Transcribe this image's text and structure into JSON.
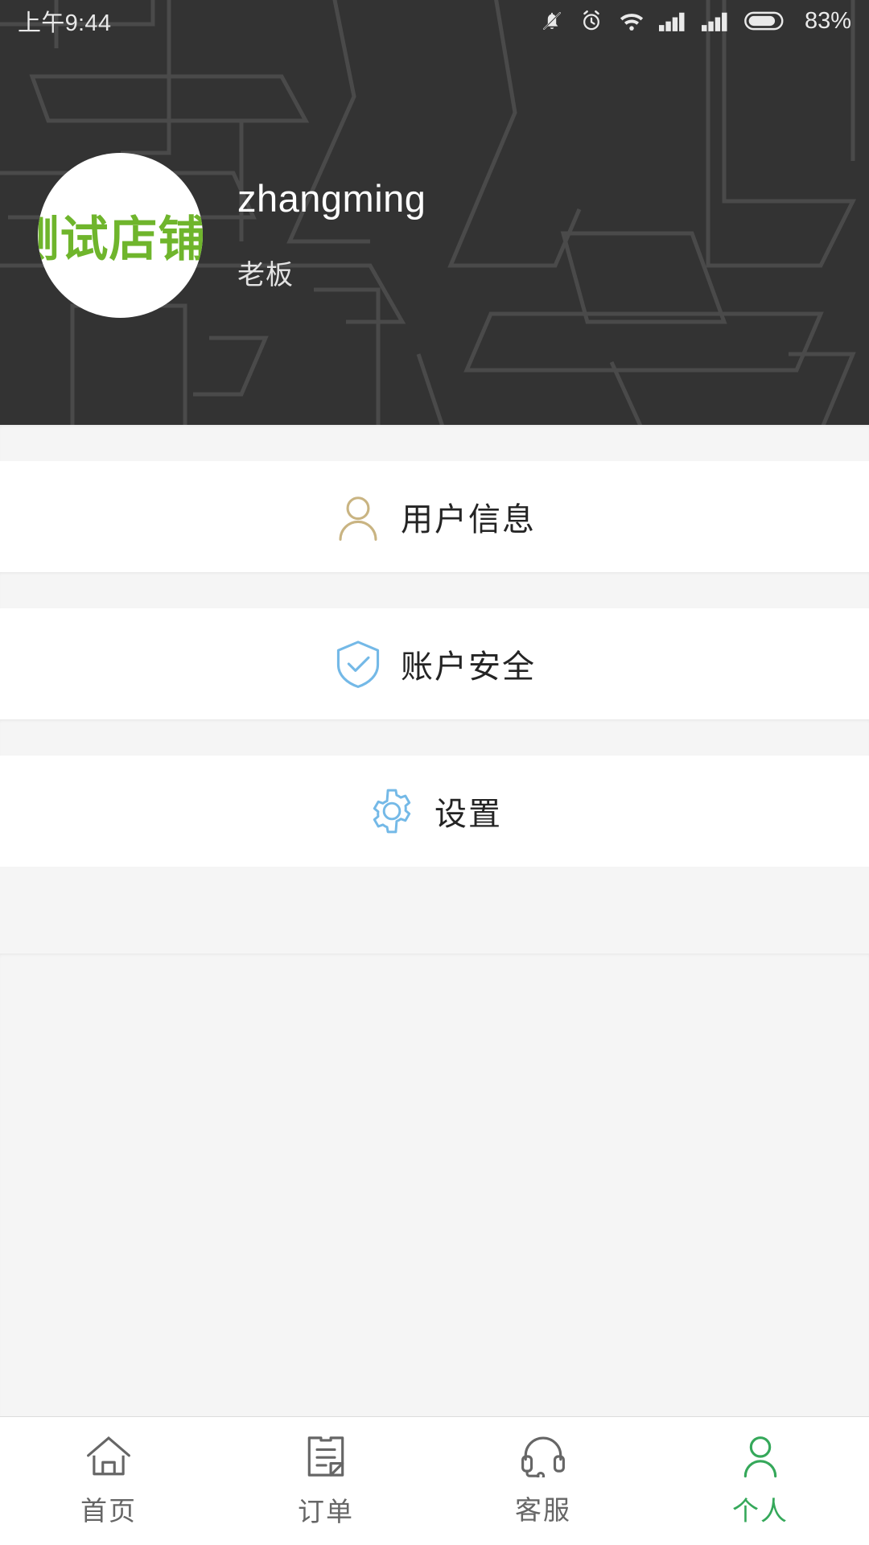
{
  "statusbar": {
    "time": "上午9:44",
    "battery_percent": "83%",
    "icons": [
      "bell-muted-icon",
      "alarm-clock-icon",
      "wifi-icon",
      "signal-bars-icon",
      "signal-bars-icon",
      "battery-icon"
    ]
  },
  "header": {
    "avatar_text": "测试店铺",
    "avatar_color": "#6fb52c",
    "name": "zhangming",
    "role": "老板",
    "background_color": "#333333"
  },
  "menu": {
    "items": [
      {
        "label": "用户信息",
        "icon": "user-icon",
        "color": "#c9b482"
      },
      {
        "label": "账户安全",
        "icon": "shield-check-icon",
        "color": "#74b9e7"
      },
      {
        "label": "设置",
        "icon": "gear-icon",
        "color": "#74b9e7"
      }
    ]
  },
  "tabbar": {
    "active_color": "#35a85a",
    "inactive_color": "#666666",
    "tabs": [
      {
        "label": "首页",
        "icon": "home-icon",
        "active": false
      },
      {
        "label": "订单",
        "icon": "document-icon",
        "active": false
      },
      {
        "label": "客服",
        "icon": "headset-icon",
        "active": false
      },
      {
        "label": "个人",
        "icon": "person-icon",
        "active": true
      }
    ]
  }
}
